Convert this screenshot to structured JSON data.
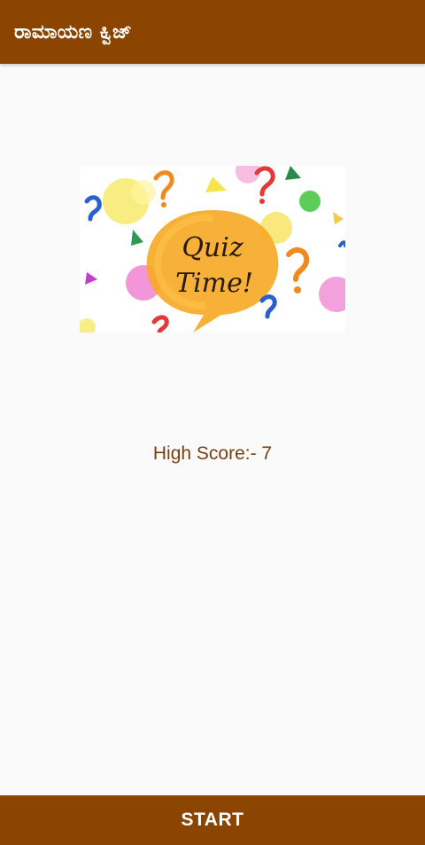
{
  "app": {
    "title": "ರಾಮಾಯಣ ಕ್ವಿಜ್",
    "accent_color": "#8b4500"
  },
  "banner": {
    "image_text_line1": "Quiz",
    "image_text_line2": "Time!"
  },
  "score": {
    "label": "High Score:- 7"
  },
  "actions": {
    "start_label": "START"
  }
}
